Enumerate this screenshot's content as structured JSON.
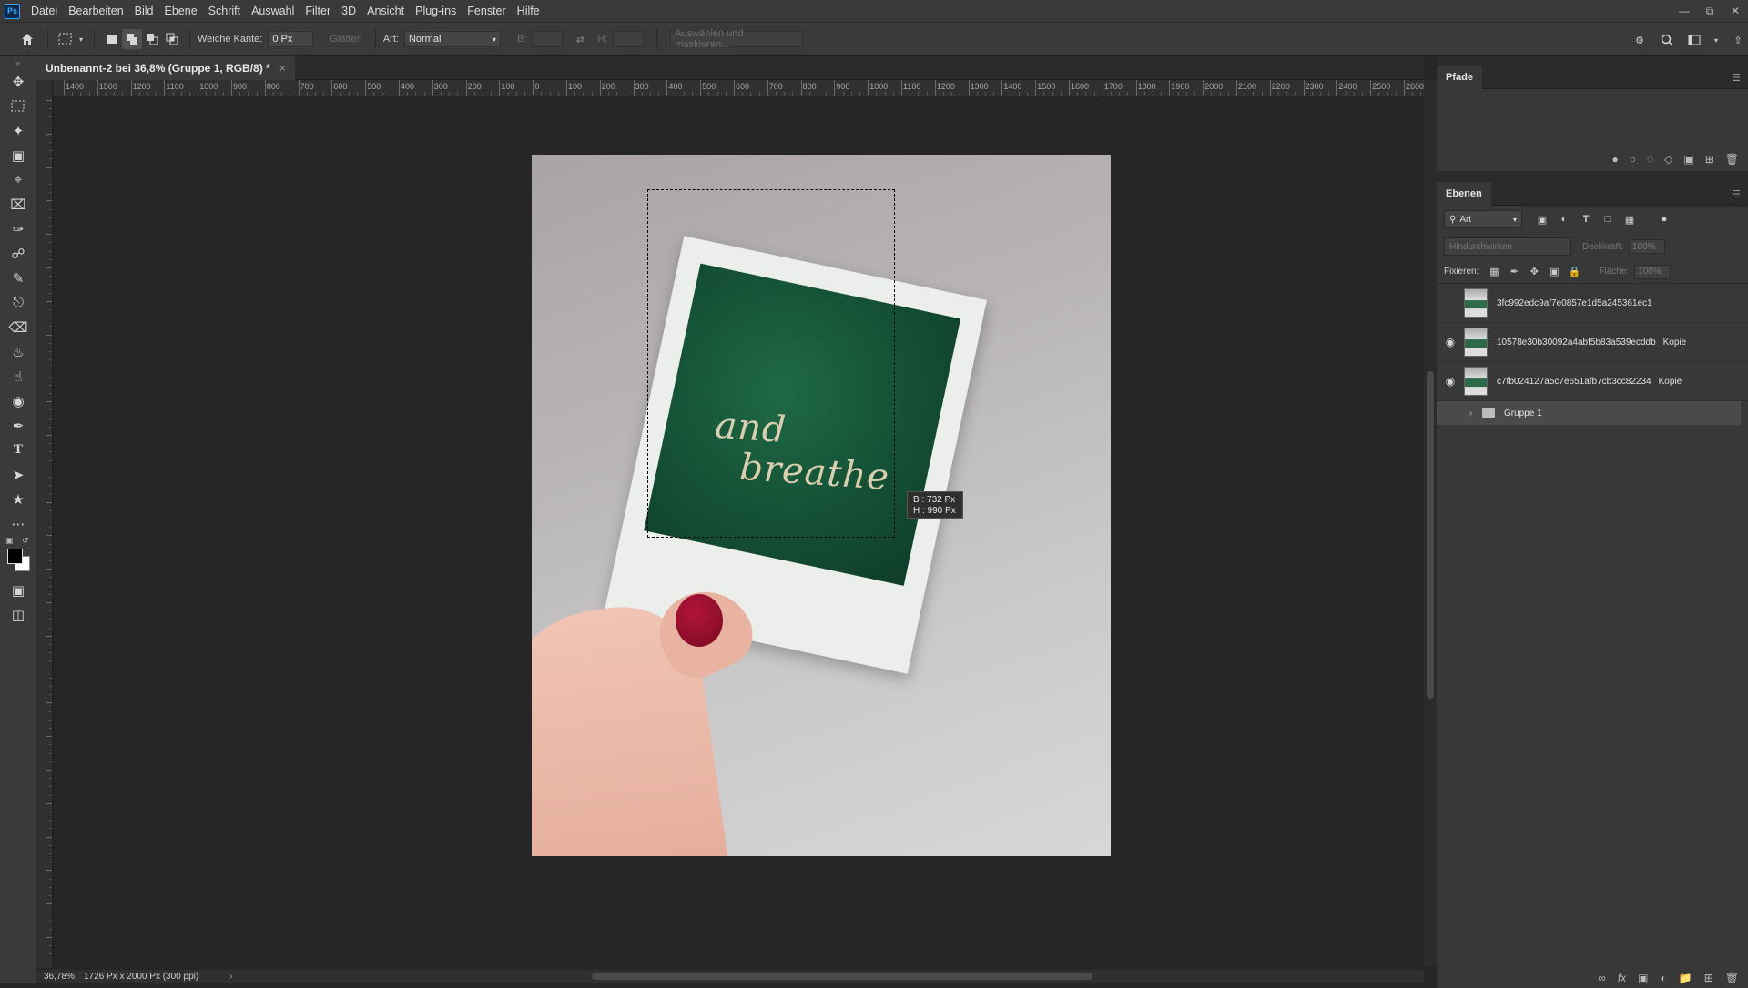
{
  "menu": {
    "logo": "Ps",
    "items": [
      "Datei",
      "Bearbeiten",
      "Bild",
      "Ebene",
      "Schrift",
      "Auswahl",
      "Filter",
      "3D",
      "Ansicht",
      "Plug-ins",
      "Fenster",
      "Hilfe"
    ]
  },
  "options": {
    "feather_label": "Weiche Kante:",
    "feather_value": "0 Px",
    "antialias_label": "Glätten",
    "style_label": "Art:",
    "style_value": "Normal",
    "width_label": "B:",
    "height_label": "H:",
    "select_mask_label": "Auswählen und maskieren..."
  },
  "document": {
    "tab_title": "Unbenannt-2 bei 36,8% (Gruppe 1, RGB/8) *",
    "close_glyph": "×"
  },
  "ruler_labels": [
    "1400",
    "1500",
    "1200",
    "1100",
    "1000",
    "900",
    "800",
    "700",
    "600",
    "500",
    "400",
    "300",
    "200",
    "100",
    "0",
    "100",
    "200",
    "300",
    "400",
    "500",
    "600",
    "700",
    "800",
    "900",
    "1000",
    "1100",
    "1200",
    "1300",
    "1400",
    "1500",
    "1600",
    "1700",
    "1800",
    "1900",
    "2000",
    "2100",
    "2200",
    "2300",
    "2400",
    "2500",
    "2600"
  ],
  "canvas": {
    "photo_text_line1": "and",
    "photo_text_line2": "breathe",
    "tooltip_w": "B :  732 Px",
    "tooltip_h": "H :  990 Px"
  },
  "status": {
    "zoom": "36,78%",
    "doc_info": "1726 Px x 2000 Px (300 ppi)",
    "arrow": "›"
  },
  "panels": {
    "paths_tab": "Pfade",
    "layers_tab": "Ebenen",
    "filter_value": "Art",
    "blend_mode": "Hindurchwirken",
    "opacity_label": "Deckkraft:",
    "opacity_value": "100%",
    "lock_label": "Fixieren:",
    "fill_label": "Fläche:",
    "fill_value": "100%",
    "layers": [
      {
        "name": "3fc992edc9af7e0857e1d5a245361ec1",
        "suffix": "",
        "visible": false
      },
      {
        "name": "10578e30b30092a4abf5b83a539ecddb",
        "suffix": "Kopie",
        "visible": true
      },
      {
        "name": "c7fb024127a5c7e651afb7cb3cc82234",
        "suffix": "Kopie",
        "visible": true
      }
    ],
    "group_name": "Gruppe 1"
  }
}
